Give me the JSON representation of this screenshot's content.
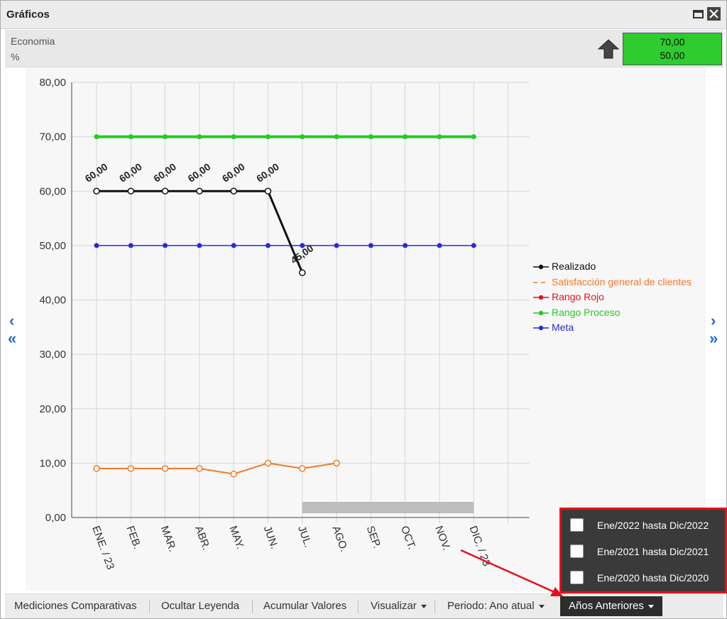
{
  "window": {
    "title": "Gráficos"
  },
  "header": {
    "indicator_name": "Economia",
    "unit": "%",
    "target_upper": "70,00",
    "target_lower": "50,00",
    "trend_icon": "up-arrow-icon",
    "target_color": "#2ecc2e"
  },
  "chart_data": {
    "type": "line",
    "categories": [
      "ENE. / 23",
      "FEB.",
      "MAR.",
      "ABR.",
      "MAY.",
      "JUN.",
      "JUL.",
      "AGO.",
      "SEP.",
      "OCT.",
      "NOV.",
      "DIC. / 23"
    ],
    "ylim": [
      0,
      80
    ],
    "yticks": [
      "0,00",
      "10,00",
      "20,00",
      "30,00",
      "40,00",
      "50,00",
      "60,00",
      "70,00",
      "80,00"
    ],
    "grid": true,
    "legend_position": "right",
    "series": [
      {
        "name": "Realizado",
        "color": "#111111",
        "values": [
          60,
          60,
          60,
          60,
          60,
          60,
          45,
          null,
          null,
          null,
          null,
          null
        ],
        "labels": [
          "60,00",
          "60,00",
          "60,00",
          "60,00",
          "60,00",
          "60,00",
          "45,00",
          "",
          "",
          "",
          "",
          ""
        ]
      },
      {
        "name": "Satisfacción general de clientes",
        "color": "#f07a2a",
        "dashed": true,
        "values": [
          9,
          9,
          9,
          9,
          8,
          10,
          9,
          10,
          null,
          null,
          null,
          null
        ]
      },
      {
        "name": "Rango Rojo",
        "color": "#e8101a",
        "values": []
      },
      {
        "name": "Rango Proceso",
        "color": "#22cc22",
        "values": [
          70,
          70,
          70,
          70,
          70,
          70,
          70,
          70,
          70,
          70,
          70,
          70
        ]
      },
      {
        "name": "Meta",
        "color": "#2a2ad8",
        "values": [
          50,
          50,
          50,
          50,
          50,
          50,
          50,
          50,
          50,
          50,
          50,
          50
        ]
      }
    ]
  },
  "navigation": {
    "prev_icon": "‹",
    "first_icon": "«",
    "next_icon": "›",
    "last_icon": "»"
  },
  "toolbar": {
    "items": [
      {
        "label": "Mediciones Comparativas"
      },
      {
        "label": "Ocultar Leyenda"
      },
      {
        "label": "Acumular Valores"
      },
      {
        "label": "Visualizar"
      },
      {
        "label": "Periodo: Ano atual"
      },
      {
        "label": "Años Anteriores"
      }
    ]
  },
  "previous_years_menu": {
    "options": [
      {
        "label": "Ene/2022 hasta Dic/2022",
        "checked": false
      },
      {
        "label": "Ene/2021 hasta Dic/2021",
        "checked": false
      },
      {
        "label": "Ene/2020 hasta Dic/2020",
        "checked": false
      }
    ]
  }
}
